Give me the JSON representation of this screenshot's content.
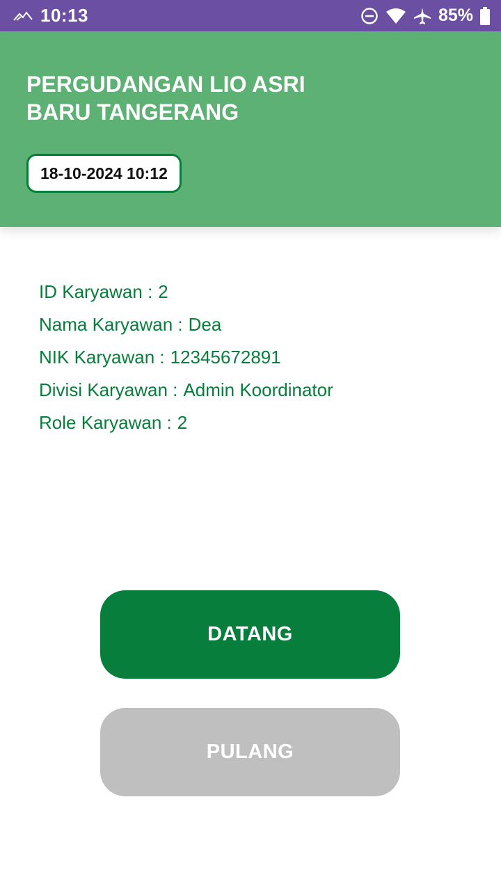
{
  "status_bar": {
    "time": "10:13",
    "battery": "85%",
    "icons": [
      "signal-mountain-icon",
      "do-not-disturb-icon",
      "wifi-icon",
      "airplane-icon",
      "battery-icon"
    ]
  },
  "header": {
    "title": "PERGUDANGAN LIO ASRI BARU TANGERANG",
    "datetime": "18-10-2024 10:12"
  },
  "employee": {
    "fields": [
      {
        "label": "ID Karyawan :",
        "value": "2"
      },
      {
        "label": "Nama Karyawan :",
        "value": "Dea"
      },
      {
        "label": "NIK Karyawan :",
        "value": "12345672891"
      },
      {
        "label": "Divisi Karyawan :",
        "value": "Admin Koordinator"
      },
      {
        "label": "Role Karyawan :",
        "value": "2"
      }
    ]
  },
  "actions": {
    "datang_label": "DATANG",
    "pulang_label": "PULANG"
  },
  "colors": {
    "status_bar": "#6a4fa3",
    "header": "#5db174",
    "accent": "#077e3b",
    "disabled": "#c0bfc0"
  }
}
